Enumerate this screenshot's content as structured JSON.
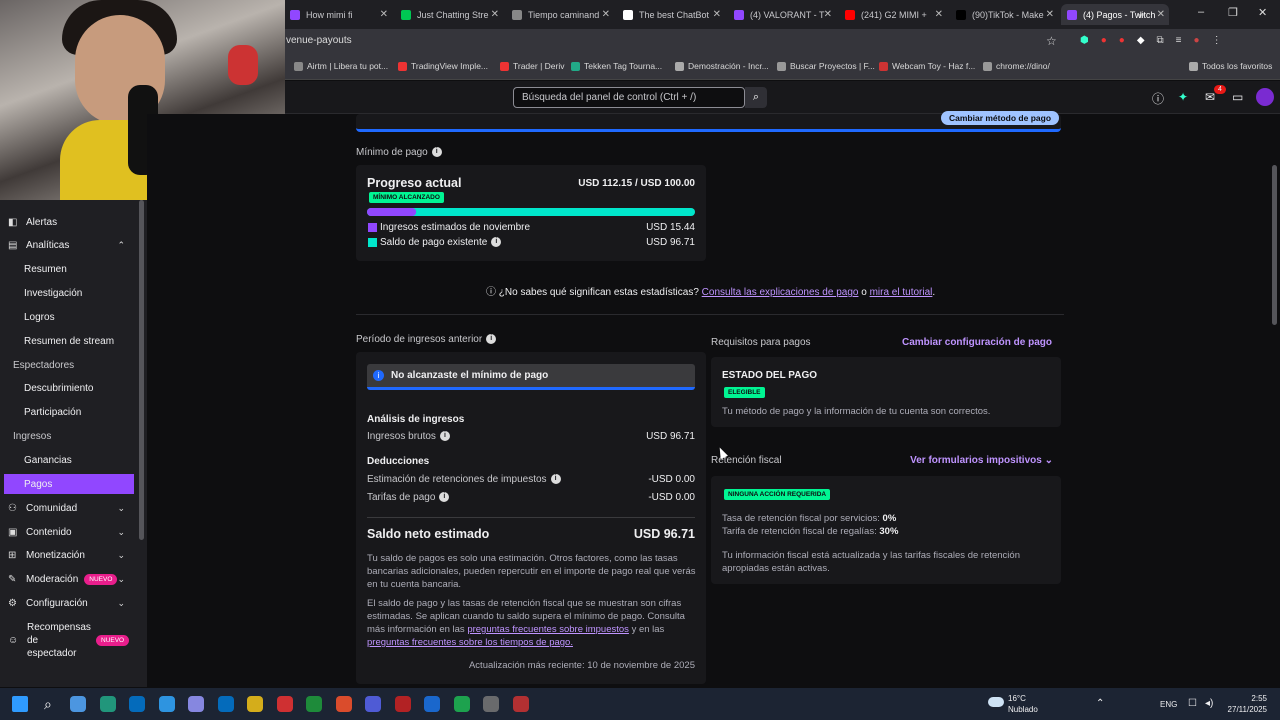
{
  "browser": {
    "tabs": [
      {
        "label": "How mimi fi",
        "color": "#9147ff"
      },
      {
        "label": "Just Chatting Stre",
        "color": "#00c853"
      },
      {
        "label": "Tiempo caminand",
        "color": "#888888"
      },
      {
        "label": "The best ChatBot",
        "color": "#ffffff"
      },
      {
        "label": "(4) VALORANT - T",
        "color": "#9147ff"
      },
      {
        "label": "(241) G2 MIMI +",
        "color": "#ff0000"
      },
      {
        "label": "(90)TikTok - Make",
        "color": "#000000"
      },
      {
        "label": "(4) Pagos - Twitch",
        "color": "#9147ff"
      }
    ],
    "address": "venue-payouts",
    "bookmarks": [
      "Airtm | Libera tu pot...",
      "TradingView Imple...",
      "Trader | Deriv",
      "Tekken Tag Tourna...",
      "Demostración - Incr...",
      "Buscar Proyectos | F...",
      "Webcam Toy - Haz f...",
      "chrome://dino/",
      "Todos los favoritos"
    ]
  },
  "topbar": {
    "search_placeholder": "Búsqueda del panel de control (Ctrl + /)",
    "notif_count": "4"
  },
  "sidebar": {
    "items": [
      {
        "label": "Alertas",
        "type": "top",
        "icon": "alert-icon"
      },
      {
        "label": "Analíticas",
        "type": "top",
        "icon": "analytics-icon",
        "chev": "⌃"
      },
      {
        "label": "Resumen",
        "type": "sub"
      },
      {
        "label": "Investigación",
        "type": "sub"
      },
      {
        "label": "Logros",
        "type": "sub"
      },
      {
        "label": "Resumen de stream",
        "type": "sub"
      },
      {
        "label": "Espectadores",
        "type": "cat"
      },
      {
        "label": "Descubrimiento",
        "type": "sub"
      },
      {
        "label": "Participación",
        "type": "sub"
      },
      {
        "label": "Ingresos",
        "type": "cat"
      },
      {
        "label": "Ganancias",
        "type": "sub"
      },
      {
        "label": "Pagos",
        "type": "active"
      },
      {
        "label": "Comunidad",
        "type": "top",
        "icon": "community-icon",
        "chev": "⌄"
      },
      {
        "label": "Contenido",
        "type": "top",
        "icon": "content-icon",
        "chev": "⌄"
      },
      {
        "label": "Monetización",
        "type": "top",
        "icon": "money-icon",
        "chev": "⌄"
      },
      {
        "label": "Moderación",
        "type": "top",
        "icon": "sword-icon",
        "chev": "⌄",
        "badge": "NUEVO"
      },
      {
        "label": "Configuración",
        "type": "top",
        "icon": "settings-icon",
        "chev": "⌄"
      }
    ],
    "rewards": {
      "label1": "Recompensas",
      "label2": "de",
      "label3": "espectador",
      "badge": "NUEVO"
    }
  },
  "payout_min": {
    "banner_button": "Cambiar método de pago",
    "section_title": "Mínimo de pago",
    "progress_title": "Progreso actual",
    "progress_value": "USD 112.15 / USD 100.00",
    "badge": "MÍNIMO ALCANZADO",
    "progress_fraction": 1.0,
    "row1_label": "Ingresos estimados de noviembre",
    "row1_value": "USD 15.44",
    "row2_label": "Saldo de pago existente",
    "row2_value": "USD 96.71",
    "colors": {
      "estimated": "#9147ff",
      "existing": "#00e6cb"
    }
  },
  "help": {
    "q": "¿No sabes qué significan estas estadísticas?",
    "link1": "Consulta las explicaciones de pago",
    "or": "o",
    "link2": "mira el tutorial",
    "end": "."
  },
  "prev_period": {
    "title": "Período de ingresos anterior",
    "alert": "No alcanzaste el mínimo de pago",
    "analysis_title": "Análisis de ingresos",
    "gross_label": "Ingresos brutos",
    "gross_value": "USD 96.71",
    "deductions_title": "Deducciones",
    "tax_label": "Estimación de retenciones de impuestos",
    "tax_value": "-USD 0.00",
    "fee_label": "Tarifas de pago",
    "fee_value": "-USD 0.00",
    "net_label": "Saldo neto estimado",
    "net_value": "USD 96.71",
    "p1": "Tu saldo de pagos es solo una estimación. Otros factores, como las tasas bancarias adicionales, pueden repercutir en el importe de pago real que verás en tu cuenta bancaria.",
    "p2a": "El saldo de pago y las tasas de retención fiscal que se muestran son cifras estimadas. Se aplican cuando tu saldo supera el mínimo de pago. Consulta más información en las",
    "p2link1": "preguntas frecuentes sobre impuestos",
    "p2b": "y en las",
    "p2link2": "preguntas frecuentes sobre los tiempos de pago.",
    "updated": "Actualización más reciente: 10 de noviembre de 2025"
  },
  "requirements": {
    "title": "Requisitos para pagos",
    "action": "Cambiar configuración de pago",
    "status_title": "ESTADO DEL PAGO",
    "status_badge": "ELEGIBLE",
    "status_text": "Tu método de pago y la información de tu cuenta son correctos."
  },
  "tax": {
    "title": "Retención fiscal",
    "action": "Ver formularios impositivos",
    "badge": "NINGUNA ACCIÓN REQUERIDA",
    "line1_label": "Tasa de retención fiscal por servicios:",
    "line1_value": "0%",
    "line2_label": "Tarifa de retención fiscal de regalías:",
    "line2_value": "30%",
    "note": "Tu información fiscal está actualizada y las tarifas fiscales de retención apropiadas están activas."
  },
  "taskbar": {
    "weather_temp": "16°C",
    "weather_desc": "Nublado",
    "lang": "ENG",
    "time": "2:55",
    "date": "27/11/2025"
  }
}
